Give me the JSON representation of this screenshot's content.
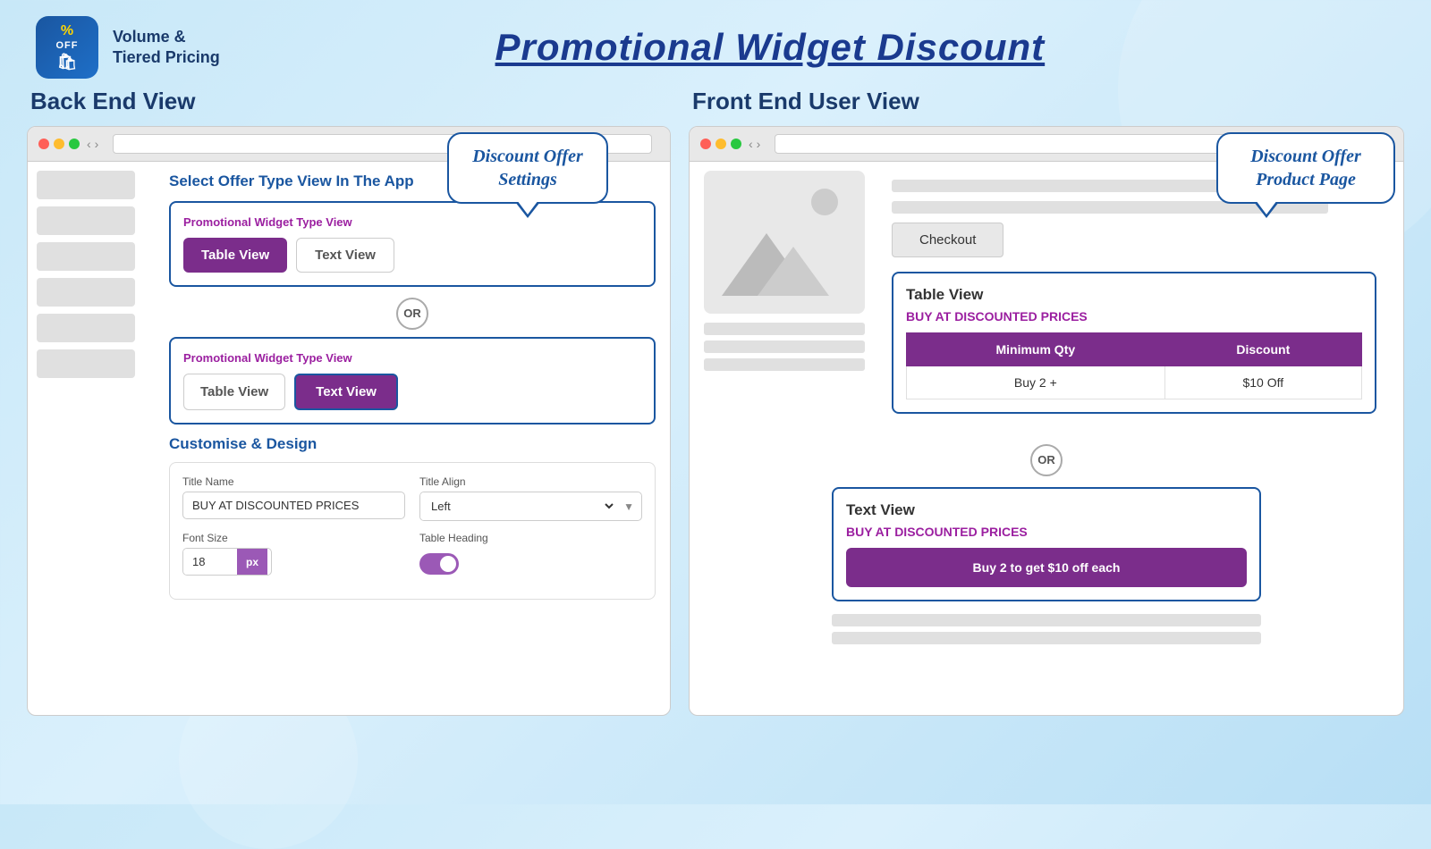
{
  "app": {
    "logo_percent": "%",
    "logo_off": "OFF",
    "title_line1": "Volume &",
    "title_line2": "Tiered Pricing"
  },
  "page": {
    "title": "Promotional Widget Discount"
  },
  "left": {
    "section_title": "Back End View",
    "select_offer_title": "Select Offer Type View In The App",
    "widget_box1": {
      "label": "Promotional Widget Type View",
      "table_view_btn": "Table View",
      "text_view_btn": "Text View"
    },
    "or_label": "OR",
    "widget_box2": {
      "label": "Promotional Widget Type View",
      "table_view_btn": "Table View",
      "text_view_btn": "Text View"
    },
    "customize_title": "Customise & Design",
    "form": {
      "title_name_label": "Title Name",
      "title_name_value": "BUY AT DISCOUNTED PRICES",
      "title_align_label": "Title Align",
      "title_align_value": "Left",
      "font_size_label": "Font Size",
      "font_size_value": "18",
      "px_label": "px",
      "table_heading_label": "Table Heading"
    },
    "callout": {
      "line1": "Discount Offer",
      "line2": "Settings"
    }
  },
  "right": {
    "section_title": "Front End User View",
    "checkout_btn": "Checkout",
    "table_view_widget": {
      "title": "Table View",
      "subtitle": "BUY AT DISCOUNTED PRICES",
      "col1_header": "Minimum Qty",
      "col2_header": "Discount",
      "row1_col1": "Buy 2 +",
      "row1_col2": "$10 Off"
    },
    "or_label": "OR",
    "text_view_widget": {
      "title": "Text View",
      "subtitle": "BUY AT DISCOUNTED PRICES",
      "offer_text": "Buy 2 to get $10 off each"
    },
    "callout": {
      "line1": "Discount Offer",
      "line2": "Product Page"
    }
  }
}
